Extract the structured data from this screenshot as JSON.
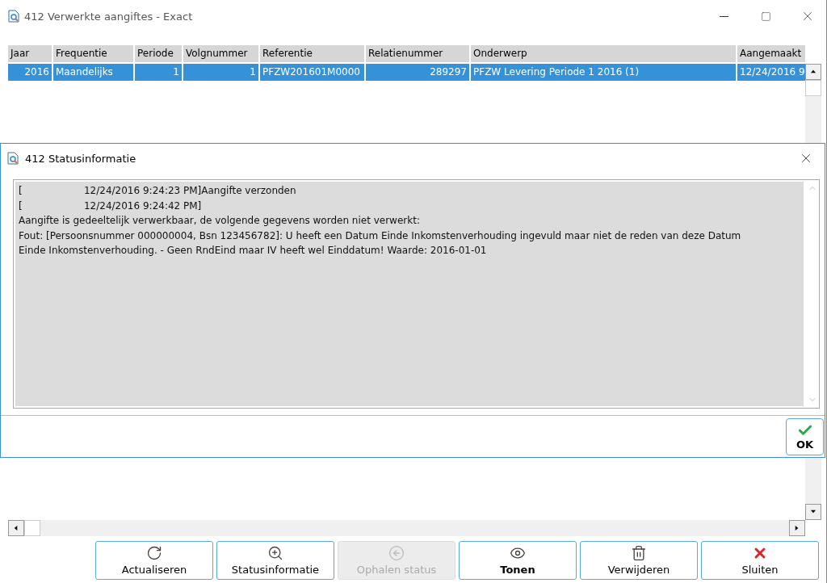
{
  "window": {
    "title": "412 Verwerkte aangiftes - Exact"
  },
  "table": {
    "columns": [
      "Jaar",
      "Frequentie",
      "Periode",
      "Volgnummer",
      "Referentie",
      "Relatienummer",
      "Onderwerp",
      "Aangemaakt"
    ],
    "rows": [
      {
        "selected": true,
        "cells": [
          "2016",
          "Maandelijks",
          "1",
          "1",
          "PFZW201601M0000",
          "289297",
          "PFZW Levering Periode 1 2016 (1)",
          "12/24/2016 9"
        ]
      }
    ]
  },
  "dialog": {
    "title": "412 Statusinformatie",
    "lines": [
      "[                    12/24/2016 9:24:23 PM]Aangifte verzonden",
      "[                    12/24/2016 9:24:42 PM]",
      "Aangifte is gedeeltelijk verwerkbaar, de volgende gegevens worden niet verwerkt:",
      "Fout: [Persoonsnummer 000000004, Bsn 123456782]: U heeft een Datum Einde Inkomstenverhouding ingevuld maar niet de reden van deze Datum",
      "Einde Inkomstenverhouding. - Geen RndEind maar IV heeft wel Einddatum! Waarde: 2016-01-01"
    ],
    "ok": "OK"
  },
  "buttons": [
    {
      "kind": "refresh",
      "label": "Actualiseren",
      "disabled": false,
      "bold": false
    },
    {
      "kind": "zoom",
      "label": "Statusinformatie",
      "disabled": false,
      "bold": false
    },
    {
      "kind": "back",
      "label": "Ophalen status",
      "disabled": true,
      "bold": false
    },
    {
      "kind": "eye",
      "label": "Tonen",
      "disabled": false,
      "bold": true
    },
    {
      "kind": "trash",
      "label": "Verwijderen",
      "disabled": false,
      "bold": false
    },
    {
      "kind": "close",
      "label": "Sluiten",
      "disabled": false,
      "bold": false
    }
  ]
}
